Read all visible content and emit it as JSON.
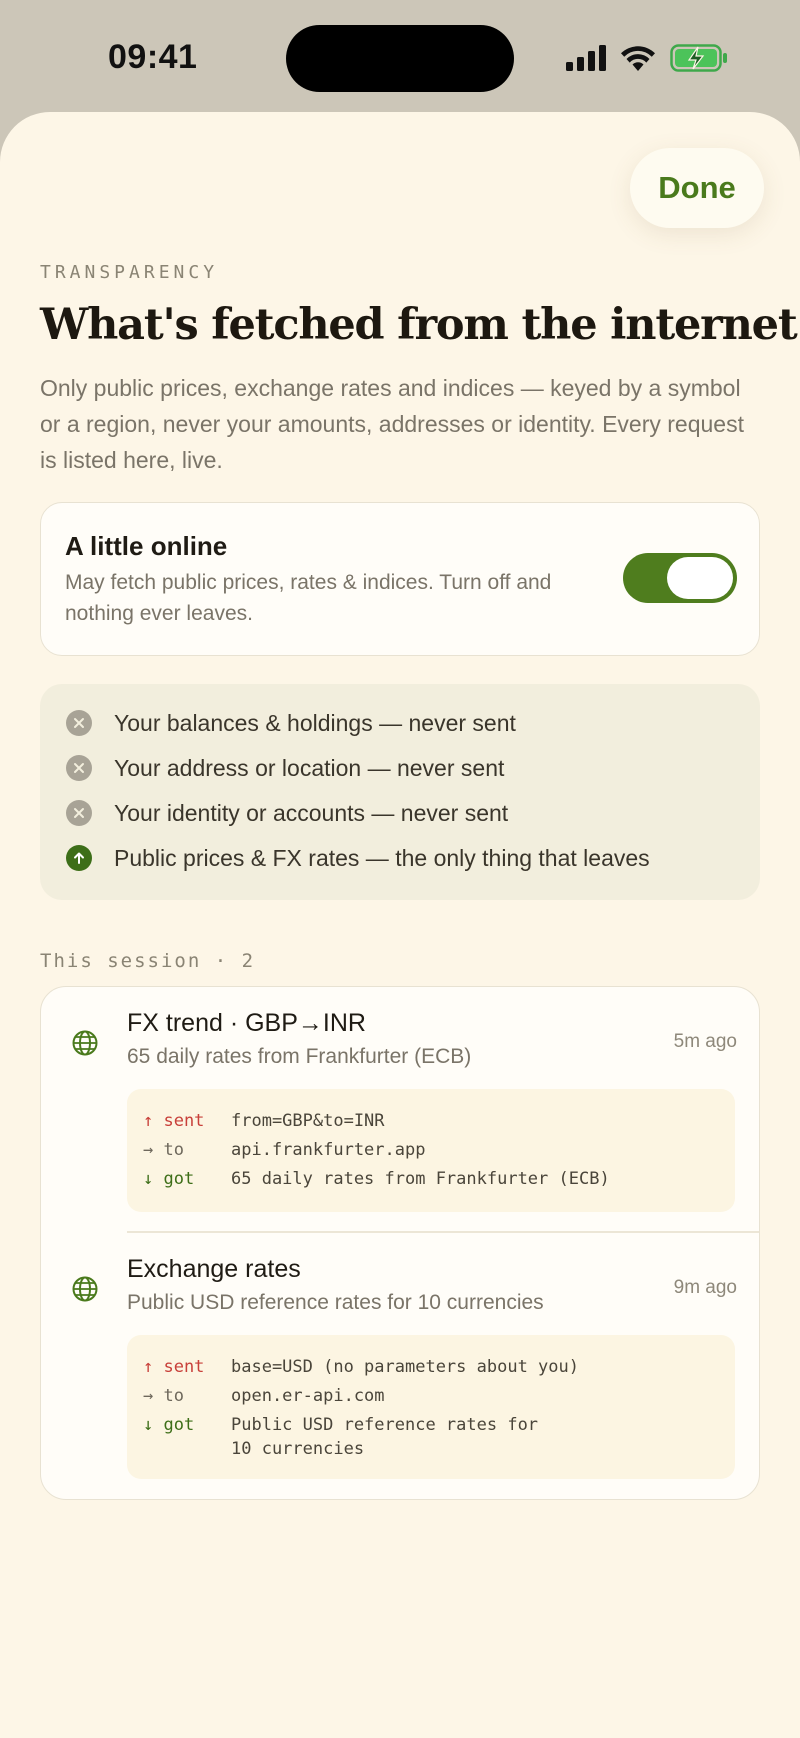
{
  "status_bar": {
    "time": "09:41"
  },
  "header": {
    "done_label": "Done",
    "eyebrow": "TRANSPARENCY",
    "title": "What's fetched from the internet",
    "lede": "Only public prices, exchange rates and indices — keyed by a symbol or a region, never your amounts, addresses or identity. Every request is listed here, live."
  },
  "toggle": {
    "title": "A little online",
    "description": "May fetch public prices, rates & indices. Turn off and nothing ever leaves.",
    "enabled": true
  },
  "privacy": {
    "items": [
      {
        "text": "Your balances & holdings — never sent",
        "status": "never",
        "icon": "x-circle-icon"
      },
      {
        "text": "Your address or location — never sent",
        "status": "never",
        "icon": "x-circle-icon"
      },
      {
        "text": "Your identity or accounts — never sent",
        "status": "never",
        "icon": "x-circle-icon"
      },
      {
        "text": "Public prices & FX rates — the only thing that leaves",
        "status": "leaves",
        "icon": "arrow-up-circle-icon"
      }
    ]
  },
  "session": {
    "label": "This session · 2",
    "requests": [
      {
        "title": "FX trend · GBP→INR",
        "subtitle": "65 daily rates from Frankfurter (ECB)",
        "time": "5m ago",
        "icon": "globe-icon",
        "log": [
          {
            "key": "↑ sent",
            "value": "from=GBP&to=INR"
          },
          {
            "key": "→ to",
            "value": "api.frankfurter.app"
          },
          {
            "key": "↓ got",
            "value": "65 daily rates from Frankfurter (ECB)"
          }
        ]
      },
      {
        "title": "Exchange rates",
        "subtitle": "Public USD reference rates for 10 currencies",
        "time": "9m ago",
        "icon": "globe-icon",
        "log": [
          {
            "key": "↑ sent",
            "value": "base=USD (no parameters about you)"
          },
          {
            "key": "→ to",
            "value": "open.er-api.com"
          },
          {
            "key": "↓ got",
            "value": "Public USD reference rates for\n10 currencies"
          }
        ]
      }
    ]
  },
  "colors": {
    "accent_green": "#4f7d1e",
    "sent_red": "#c8403a",
    "sheet_bg": "#fdf6e7"
  }
}
